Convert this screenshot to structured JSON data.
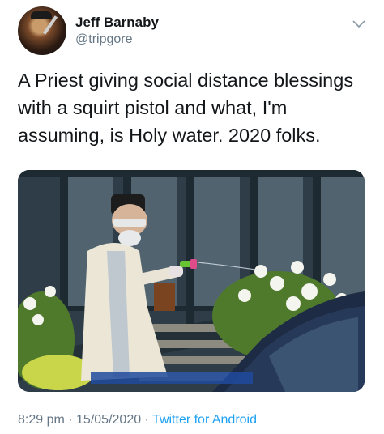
{
  "tweet": {
    "author_name": "Jeff Barnaby",
    "author_handle": "@tripgore",
    "text": "A Priest giving social distance blessings with a squirt pistol and what, I'm assuming, is Holy water. 2020 folks.",
    "time": "8:29 pm",
    "separator": " · ",
    "date": "15/05/2020",
    "app": "Twitter for Android"
  },
  "icons": {
    "avatar": "avatar-photo",
    "menu": "chevron-down-icon"
  },
  "colors": {
    "secondary_text": "#657786",
    "link": "#1da1f2",
    "primary_text": "#14171a"
  }
}
